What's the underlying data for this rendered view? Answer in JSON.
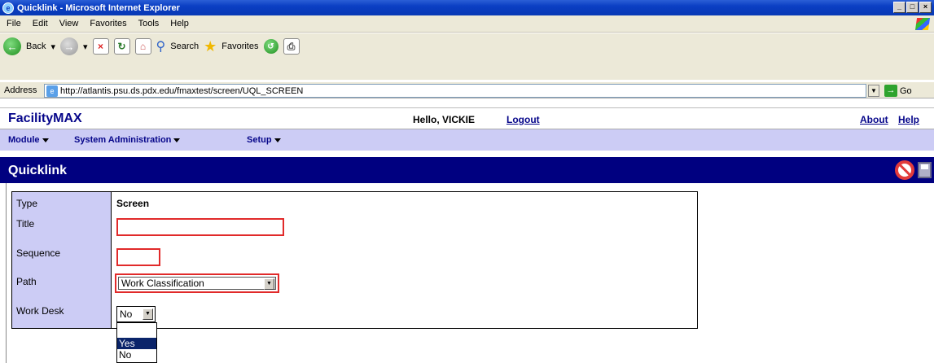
{
  "window": {
    "title": "Quicklink - Microsoft Internet Explorer"
  },
  "menu": [
    "File",
    "Edit",
    "View",
    "Favorites",
    "Tools",
    "Help"
  ],
  "toolbar": {
    "back_label": "Back",
    "search_label": "Search",
    "favorites_label": "Favorites"
  },
  "address": {
    "label": "Address",
    "url": "http://atlantis.psu.ds.pdx.edu/fmaxtest/screen/UQL_SCREEN",
    "go_label": "Go"
  },
  "app": {
    "brand": "FacilityMAX",
    "greeting": "Hello, VICKIE",
    "logout": "Logout",
    "about": "About",
    "help": "Help"
  },
  "nav": {
    "items": [
      "Module",
      "System Administration",
      "Setup"
    ]
  },
  "page": {
    "title": "Quicklink"
  },
  "form": {
    "type_label": "Type",
    "type_value": "Screen",
    "title_label": "Title",
    "title_value": "",
    "sequence_label": "Sequence",
    "sequence_value": "",
    "path_label": "Path",
    "path_value": "Work Classification",
    "workdesk_label": "Work Desk",
    "workdesk_value": "No",
    "workdesk_options": [
      "Yes",
      "No"
    ]
  },
  "colors": {
    "brand": "#06068a",
    "header_bg": "#000080",
    "nav_bg": "#ccccf5",
    "required_border": "#e12a2a"
  }
}
